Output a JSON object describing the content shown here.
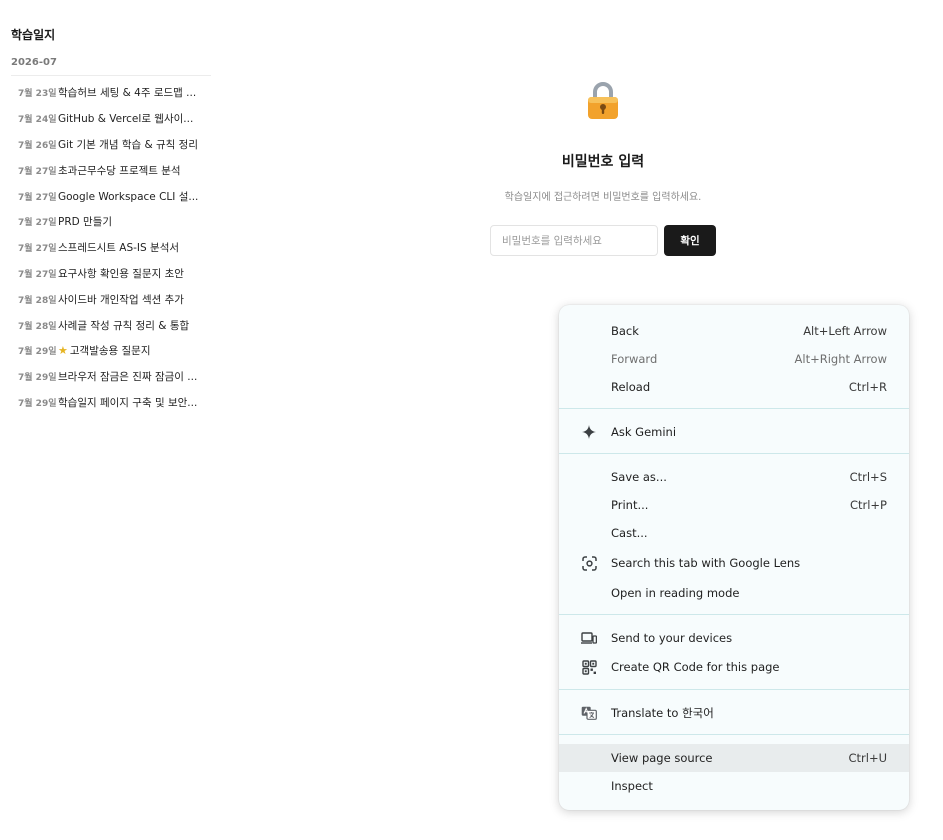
{
  "sidebar": {
    "title": "학습일지",
    "month": "2026-07",
    "entries": [
      {
        "date": "7월 23일",
        "title": "학습허브 세팅 & 4주 로드맵 ..."
      },
      {
        "date": "7월 24일",
        "title": "GitHub & Vercel로 웹사이..."
      },
      {
        "date": "7월 26일",
        "title": "Git 기본 개념 학습 & 규칙 정리"
      },
      {
        "date": "7월 27일",
        "title": "초과근무수당 프로젝트 분석"
      },
      {
        "date": "7월 27일",
        "title": "Google Workspace CLI 설..."
      },
      {
        "date": "7월 27일",
        "title": "PRD 만들기"
      },
      {
        "date": "7월 27일",
        "title": "스프레드시트 AS-IS 분석서"
      },
      {
        "date": "7월 27일",
        "title": "요구사항 확인용 질문지 초안"
      },
      {
        "date": "7월 28일",
        "title": "사이드바 개인작업 섹션 추가"
      },
      {
        "date": "7월 28일",
        "title": "사례글 작성 규칙 정리 & 통합"
      },
      {
        "date": "7월 29일",
        "title": "고객발송용 질문지",
        "star": "★"
      },
      {
        "date": "7월 29일",
        "title": "브라우저 잠금은 진짜 잠금이 ..."
      },
      {
        "date": "7월 29일",
        "title": "학습일지 페이지 구축 및 보안..."
      }
    ]
  },
  "gate": {
    "title": "비밀번호 입력",
    "description": "학습일지에 접근하려면 비밀번호를 입력하세요.",
    "placeholder": "비밀번호를 입력하세요",
    "button": "확인"
  },
  "context_menu": {
    "back": {
      "label": "Back",
      "shortcut": "Alt+Left Arrow"
    },
    "forward": {
      "label": "Forward",
      "shortcut": "Alt+Right Arrow"
    },
    "reload": {
      "label": "Reload",
      "shortcut": "Ctrl+R"
    },
    "ask_gemini": {
      "label": "Ask Gemini"
    },
    "save_as": {
      "label": "Save as...",
      "shortcut": "Ctrl+S"
    },
    "print": {
      "label": "Print...",
      "shortcut": "Ctrl+P"
    },
    "cast": {
      "label": "Cast..."
    },
    "google_lens": {
      "label": "Search this tab with Google Lens"
    },
    "reading_mode": {
      "label": "Open in reading mode"
    },
    "send_devices": {
      "label": "Send to your devices"
    },
    "qr_code": {
      "label": "Create QR Code for this page"
    },
    "translate": {
      "label": "Translate to 한국어"
    },
    "view_source": {
      "label": "View page source",
      "shortcut": "Ctrl+U"
    },
    "inspect": {
      "label": "Inspect"
    }
  },
  "colors": {
    "button_bg": "#1a1a1a",
    "menu_bg": "#f7fcfd",
    "menu_separator": "#cde8ea",
    "menu_hover": "#e8eced",
    "star": "#e6b422"
  }
}
